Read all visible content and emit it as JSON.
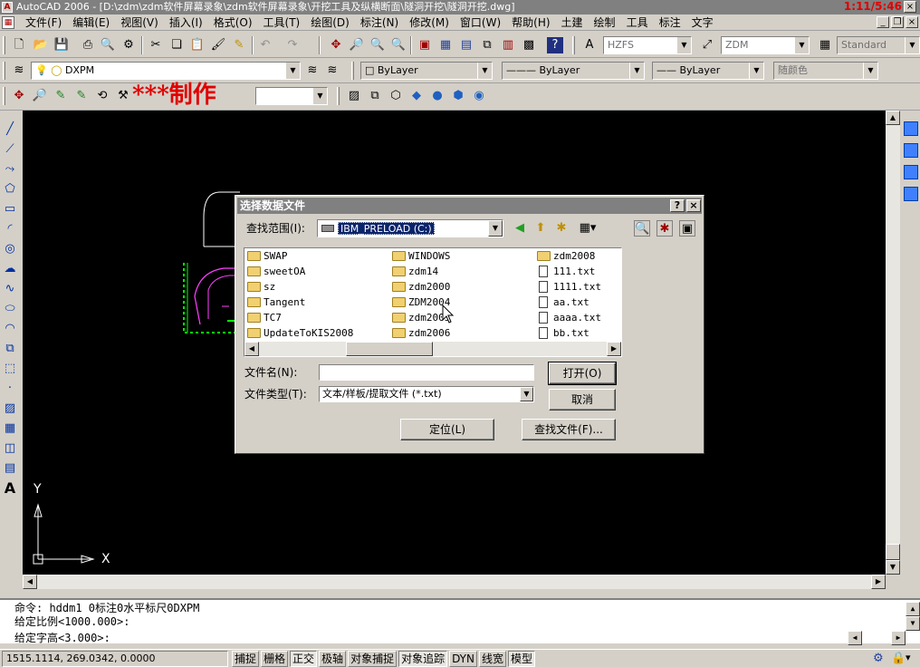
{
  "window": {
    "title": "AutoCAD 2006 - [D:\\zdm\\zdm软件屏幕录象\\zdm软件屏幕录象\\开挖工具及纵横断面\\隧洞开挖\\隧洞开挖.dwg]",
    "clock": "1:11/5:46",
    "app_icon": "A"
  },
  "menu": [
    "文件(F)",
    "编辑(E)",
    "视图(V)",
    "插入(I)",
    "格式(O)",
    "工具(T)",
    "绘图(D)",
    "标注(N)",
    "修改(M)",
    "窗口(W)",
    "帮助(H)",
    "土建",
    "绘制",
    "工具",
    "标注",
    "文字"
  ],
  "toolbars": {
    "text_style": "HZFS",
    "dim_style": "ZDM",
    "table_style": "Standard",
    "layer": "DXPM",
    "color": "ByLayer",
    "linetype": "ByLayer",
    "lineweight": "ByLayer",
    "plot_style": "随颜色",
    "watermark": "***制作"
  },
  "dialog": {
    "title": "选择数据文件",
    "help": "?",
    "close": "×",
    "lookin_label": "查找范围(I):",
    "lookin_value": "IBM_PRELOAD (C:)",
    "files": [
      {
        "name": "SWAP",
        "kind": "folder"
      },
      {
        "name": "sweetOA",
        "kind": "folder"
      },
      {
        "name": "sz",
        "kind": "folder"
      },
      {
        "name": "Tangent",
        "kind": "folder"
      },
      {
        "name": "TC7",
        "kind": "folder"
      },
      {
        "name": "UpdateToKIS2008",
        "kind": "folder"
      },
      {
        "name": "WINDOWS",
        "kind": "folder"
      },
      {
        "name": "zdm14",
        "kind": "folder"
      },
      {
        "name": "zdm2000",
        "kind": "folder"
      },
      {
        "name": "ZDM2004",
        "kind": "folder"
      },
      {
        "name": "zdm2005",
        "kind": "folder"
      },
      {
        "name": "zdm2006",
        "kind": "folder"
      },
      {
        "name": "zdm2008",
        "kind": "folder"
      },
      {
        "name": "111.txt",
        "kind": "txt"
      },
      {
        "name": "1111.txt",
        "kind": "txt"
      },
      {
        "name": "aa.txt",
        "kind": "txt"
      },
      {
        "name": "aaaa.txt",
        "kind": "txt"
      },
      {
        "name": "bb.txt",
        "kind": "txt"
      }
    ],
    "filename_label": "文件名(N):",
    "filename_value": "",
    "filetype_label": "文件类型(T):",
    "filetype_value": "文本/样板/提取文件 (*.txt)",
    "open_button": "打开(O)",
    "cancel_button": "取消",
    "locate_button": "定位(L)",
    "find_button": "查找文件(F)..."
  },
  "ucs": {
    "x_label": "X",
    "y_label": "Y"
  },
  "command": {
    "lines": [
      "命令: hddm1 0标注0水平标尺0DXPM",
      "给定比例<1000.000>:",
      "给定字高<3.000>:"
    ]
  },
  "status": {
    "coords": "1515.1114, 269.0342, 0.0000",
    "toggles": [
      {
        "label": "捕捉",
        "on": false
      },
      {
        "label": "栅格",
        "on": false
      },
      {
        "label": "正交",
        "on": true
      },
      {
        "label": "极轴",
        "on": false
      },
      {
        "label": "对象捕捉",
        "on": false
      },
      {
        "label": "对象追踪",
        "on": true
      },
      {
        "label": "DYN",
        "on": false
      },
      {
        "label": "线宽",
        "on": false
      },
      {
        "label": "模型",
        "on": true
      }
    ]
  }
}
